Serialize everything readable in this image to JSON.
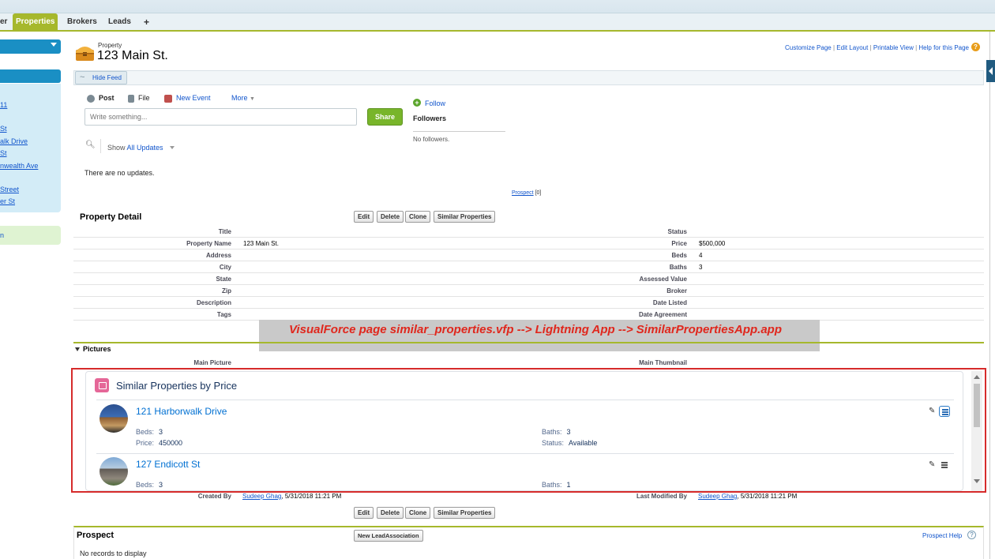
{
  "tabs": [
    {
      "label": "er"
    },
    {
      "label": "Properties"
    },
    {
      "label": "Brokers"
    },
    {
      "label": "Leads"
    },
    {
      "label": "+"
    }
  ],
  "sidebar": {
    "links": [
      "11",
      "St",
      "alk Drive",
      "St",
      "nwealth Ave",
      "Street",
      "er St"
    ],
    "green_link": "n"
  },
  "header": {
    "eyebrow": "Property",
    "title": "123 Main St.",
    "links": [
      "Customize Page",
      "Edit Layout",
      "Printable View",
      "Help for this Page"
    ],
    "link_separator": "|",
    "help_icon": "?"
  },
  "feed": {
    "hide_feed_label": "Hide Feed",
    "tabs": {
      "post": "Post",
      "file": "File",
      "new_event": "New Event",
      "more": "More"
    },
    "post_placeholder": "Write something...",
    "share_label": "Share",
    "show_label": "Show",
    "show_link": "All Updates",
    "no_updates": "There are no updates.",
    "follow_label": "Follow",
    "followers_label": "Followers",
    "no_followers": "No followers.",
    "prospect_link": "Prospect",
    "prospect_count": "[0]"
  },
  "property_detail": {
    "title": "Property Detail",
    "buttons": [
      "Edit",
      "Delete",
      "Clone",
      "Similar Properties"
    ],
    "rows": [
      {
        "l_label": "Title",
        "l_value": "",
        "r_label": "Status",
        "r_value": ""
      },
      {
        "l_label": "Property Name",
        "l_value": "123 Main St.",
        "r_label": "Price",
        "r_value": "$500,000"
      },
      {
        "l_label": "Address",
        "l_value": "",
        "r_label": "Beds",
        "r_value": "4"
      },
      {
        "l_label": "City",
        "l_value": "",
        "r_label": "Baths",
        "r_value": "3"
      },
      {
        "l_label": "State",
        "l_value": "",
        "r_label": "Assessed Value",
        "r_value": ""
      },
      {
        "l_label": "Zip",
        "l_value": "",
        "r_label": "Broker",
        "r_value": ""
      },
      {
        "l_label": "Description",
        "l_value": "",
        "r_label": "Date Listed",
        "r_value": ""
      },
      {
        "l_label": "Tags",
        "l_value": "",
        "r_label": "Date Agreement",
        "r_value": ""
      }
    ]
  },
  "annotation": "VisualForce page similar_properties.vfp --> Lightning App --> SimilarPropertiesApp.app",
  "pictures": {
    "title": "Pictures",
    "main_picture_label": "Main Picture",
    "main_thumbnail_label": "Main Thumbnail"
  },
  "similar": {
    "title": "Similar Properties by Price",
    "items": [
      {
        "name": "121 Harborwalk Drive",
        "beds_label": "Beds:",
        "beds": "3",
        "baths_label": "Baths:",
        "baths": "3",
        "price_label": "Price:",
        "price": "450000",
        "status_label": "Status:",
        "status": "Available"
      },
      {
        "name": "127 Endicott St",
        "beds_label": "Beds:",
        "beds": "3",
        "baths_label": "Baths:",
        "baths": "1"
      }
    ]
  },
  "audit": {
    "created_label": "Created By",
    "created_user": "Sudeep Ghag",
    "created_date": ", 5/31/2018 11:21 PM",
    "modified_label": "Last Modified By",
    "modified_user": "Sudeep Ghag",
    "modified_date": ", 5/31/2018 11:21 PM"
  },
  "bottom_buttons": [
    "Edit",
    "Delete",
    "Clone",
    "Similar Properties"
  ],
  "prospect": {
    "title": "Prospect",
    "new_button": "New LeadAssociation",
    "help_link": "Prospect Help",
    "help_icon": "?",
    "empty": "No records to display"
  },
  "colors": {
    "accent": "#a6b82c",
    "brand_blue": "#1a8fc4",
    "link": "#1155cc",
    "annotation_red": "#e0271d"
  }
}
